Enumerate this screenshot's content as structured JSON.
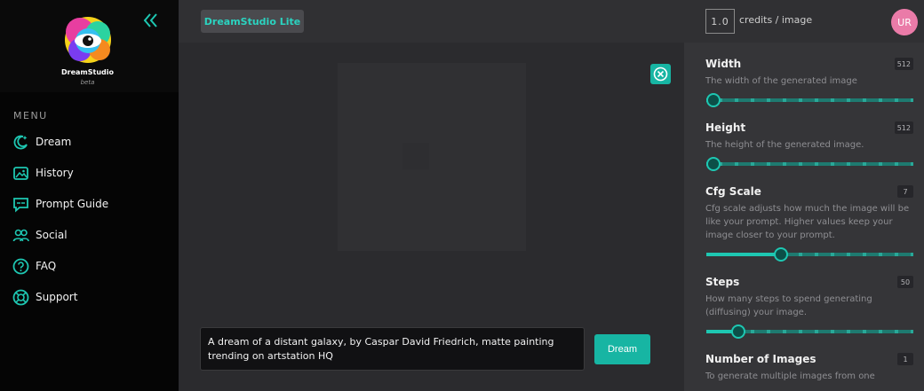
{
  "brand": {
    "name": "DreamStudio",
    "subtitle": "beta"
  },
  "menu": {
    "title": "MENU",
    "items": [
      {
        "label": "Dream",
        "icon": "dream-icon"
      },
      {
        "label": "History",
        "icon": "history-icon"
      },
      {
        "label": "Prompt Guide",
        "icon": "prompt-guide-icon"
      },
      {
        "label": "Social",
        "icon": "social-icon"
      },
      {
        "label": "FAQ",
        "icon": "faq-icon"
      },
      {
        "label": "Support",
        "icon": "support-icon"
      }
    ]
  },
  "topbar": {
    "tab_label": "DreamStudio Lite",
    "credits_value": "1.0",
    "credits_label": "credits / image",
    "avatar_initials": "UR"
  },
  "main": {
    "prompt": "A dream of a distant galaxy, by Caspar David Friedrich, matte painting trending on artstation HQ",
    "dream_button": "Dream"
  },
  "settings": [
    {
      "title": "Width",
      "value": "512",
      "description": "The width of the generated image",
      "slider_fraction": 0.0
    },
    {
      "title": "Height",
      "value": "512",
      "description": "The height of the generated image.",
      "slider_fraction": 0.0
    },
    {
      "title": "Cfg Scale",
      "value": "7",
      "description": "Cfg scale adjusts how much the image will be like your prompt. Higher values keep your image closer to your prompt.",
      "slider_fraction": 0.35
    },
    {
      "title": "Steps",
      "value": "50",
      "description": "How many steps to spend generating (diffusing) your image.",
      "slider_fraction": 0.13
    },
    {
      "title": "Number of Images",
      "value": "1",
      "description": "To generate multiple images from one"
    }
  ],
  "colors": {
    "accent": "#17b5a3",
    "sidebar_bg": "#050505",
    "panel_bg": "#353538",
    "avatar": "#ea7ba8"
  }
}
